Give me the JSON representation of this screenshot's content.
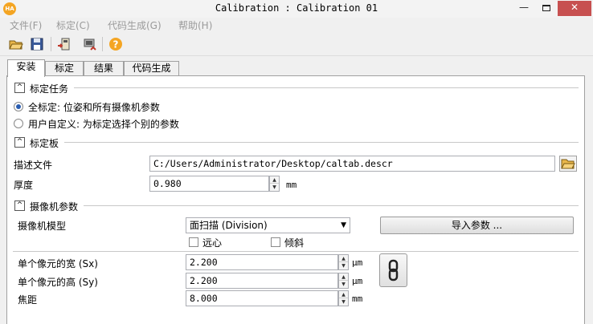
{
  "window": {
    "app_icon": "HA",
    "title": "Calibration : Calibration 01",
    "minimize": "—",
    "close": "✕"
  },
  "menu": [
    "文件(F)",
    "标定(C)",
    "代码生成(G)",
    "帮助(H)"
  ],
  "toolbar": {
    "icons": [
      "open-folder-icon",
      "save-icon",
      "camera-import-icon",
      "camera-export-icon",
      "help-icon"
    ]
  },
  "tabs": [
    {
      "label": "安装",
      "active": true
    },
    {
      "label": "标定",
      "active": false
    },
    {
      "label": "结果",
      "active": false
    },
    {
      "label": "代码生成",
      "active": false
    }
  ],
  "calib_task": {
    "header": "标定任务",
    "options": [
      {
        "label": "全标定: 位姿和所有摄像机参数",
        "selected": true
      },
      {
        "label": "用户自定义: 为标定选择个别的参数",
        "selected": false
      }
    ]
  },
  "calib_plate": {
    "header": "标定板",
    "desc_label": "描述文件",
    "desc_value": "C:/Users/Administrator/Desktop/caltab.descr",
    "thickness_label": "厚度",
    "thickness_value": "0.980",
    "thickness_unit": "mm"
  },
  "camera_params": {
    "header": "摄像机参数",
    "model_label": "摄像机模型",
    "model_value": "面扫描 (Division)",
    "import_button": "导入参数 ...",
    "telecentric_label": "远心",
    "tilt_label": "倾斜",
    "sx_label": "单个像元的宽 (Sx)",
    "sx_value": "2.200",
    "sx_unit": "μm",
    "sy_label": "单个像元的高 (Sy)",
    "sy_value": "2.200",
    "sy_unit": "μm",
    "focal_label": "焦距",
    "focal_value": "8.000",
    "focal_unit": "mm"
  },
  "colors": {
    "close_button": "#c75050",
    "app_icon": "#f4a523",
    "radio_selected": "#2a5db0"
  }
}
